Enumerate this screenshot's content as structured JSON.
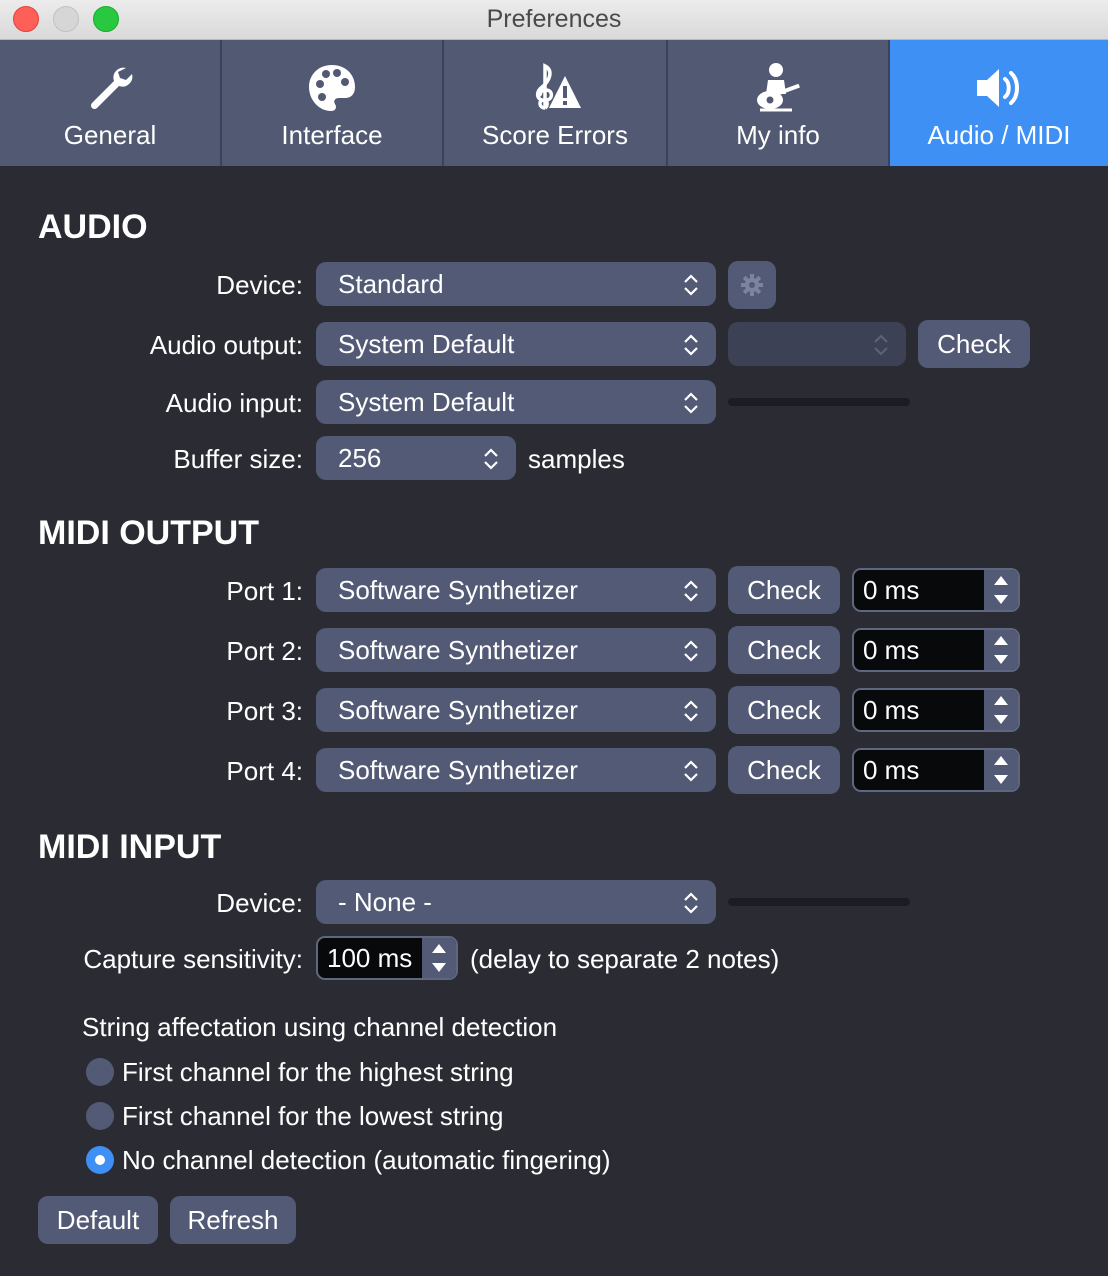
{
  "window": {
    "title": "Preferences"
  },
  "tabs": [
    {
      "label": "General",
      "icon": "wrench-icon"
    },
    {
      "label": "Interface",
      "icon": "palette-icon"
    },
    {
      "label": "Score Errors",
      "icon": "clef-warning-icon"
    },
    {
      "label": "My info",
      "icon": "guitarist-icon"
    },
    {
      "label": "Audio / MIDI",
      "icon": "speaker-icon",
      "active": true
    }
  ],
  "audio": {
    "heading": "AUDIO",
    "device_label": "Device:",
    "device_value": "Standard",
    "output_label": "Audio output:",
    "output_value": "System Default",
    "output_secondary_value": "",
    "check_label": "Check",
    "input_label": "Audio input:",
    "input_value": "System Default",
    "buffer_label": "Buffer size:",
    "buffer_value": "256",
    "buffer_unit": "samples"
  },
  "midi_output": {
    "heading": "MIDI OUTPUT",
    "ports": [
      {
        "label": "Port 1:",
        "value": "Software Synthetizer",
        "check": "Check",
        "delay": "0 ms"
      },
      {
        "label": "Port 2:",
        "value": "Software Synthetizer",
        "check": "Check",
        "delay": "0 ms"
      },
      {
        "label": "Port 3:",
        "value": "Software Synthetizer",
        "check": "Check",
        "delay": "0 ms"
      },
      {
        "label": "Port 4:",
        "value": "Software Synthetizer",
        "check": "Check",
        "delay": "0 ms"
      }
    ]
  },
  "midi_input": {
    "heading": "MIDI INPUT",
    "device_label": "Device:",
    "device_value": "- None -",
    "capture_label": "Capture sensitivity:",
    "capture_value": "100 ms",
    "capture_note": "(delay to separate 2 notes)",
    "string_heading": "String affectation using channel detection",
    "options": [
      {
        "label": "First channel for the highest string",
        "selected": false
      },
      {
        "label": "First channel for the lowest string",
        "selected": false
      },
      {
        "label": "No channel detection (automatic fingering)",
        "selected": true
      }
    ]
  },
  "footer": {
    "default_label": "Default",
    "refresh_label": "Refresh"
  },
  "colors": {
    "accent": "#3f90f5",
    "background": "#2b2c33",
    "control": "#535a75"
  }
}
